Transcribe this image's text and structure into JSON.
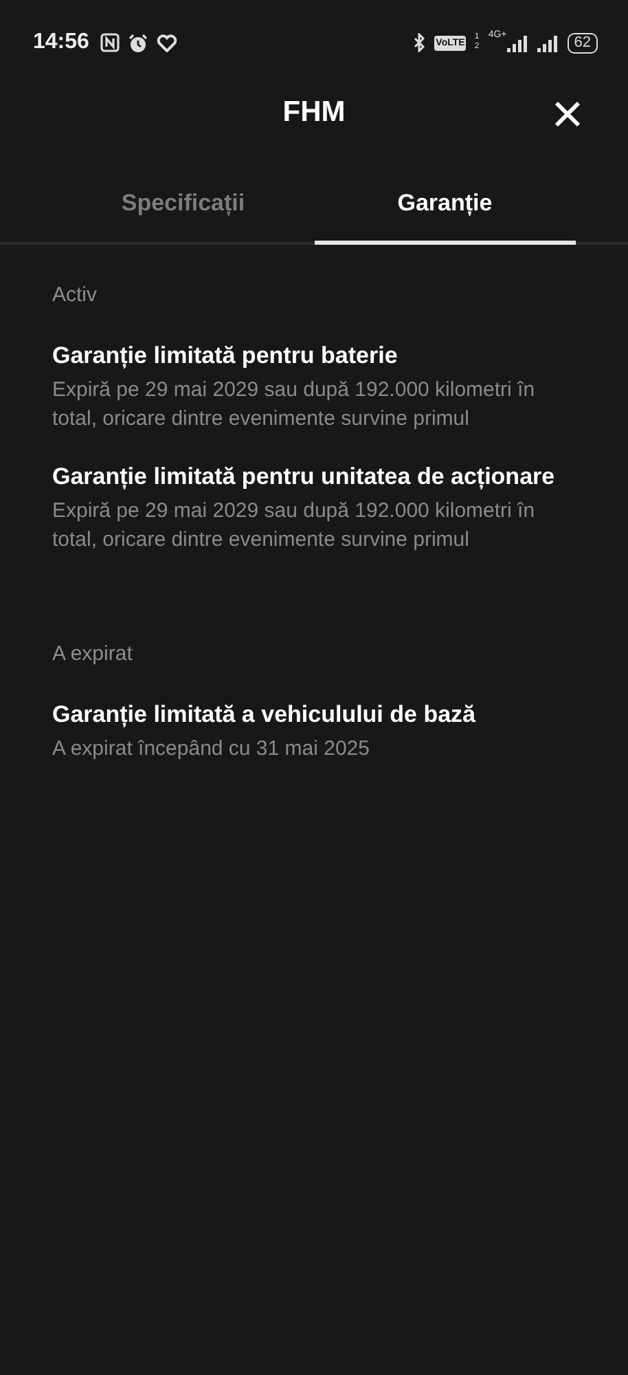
{
  "status_bar": {
    "time": "14:56",
    "volte": "VoLTE",
    "sim_slots": "1 2",
    "network": "4G+",
    "battery": "62"
  },
  "header": {
    "title": "FHM"
  },
  "tabs": [
    {
      "label": "Specificații",
      "selected": false
    },
    {
      "label": "Garanție",
      "selected": true
    }
  ],
  "sections": [
    {
      "heading": "Activ",
      "items": [
        {
          "title": "Garanție limitată pentru baterie",
          "detail": "Expiră pe 29 mai 2029 sau după 192.000 kilometri în total, oricare dintre evenimente survine primul"
        },
        {
          "title": "Garanție limitată pentru unitatea de acționare",
          "detail": "Expiră pe 29 mai 2029 sau după 192.000 kilometri în total, oricare dintre evenimente survine primul"
        }
      ]
    },
    {
      "heading": "A expirat",
      "items": [
        {
          "title": "Garanție limitată a vehiculului de bază",
          "detail": "A expirat începând cu 31 mai 2025"
        }
      ]
    }
  ]
}
